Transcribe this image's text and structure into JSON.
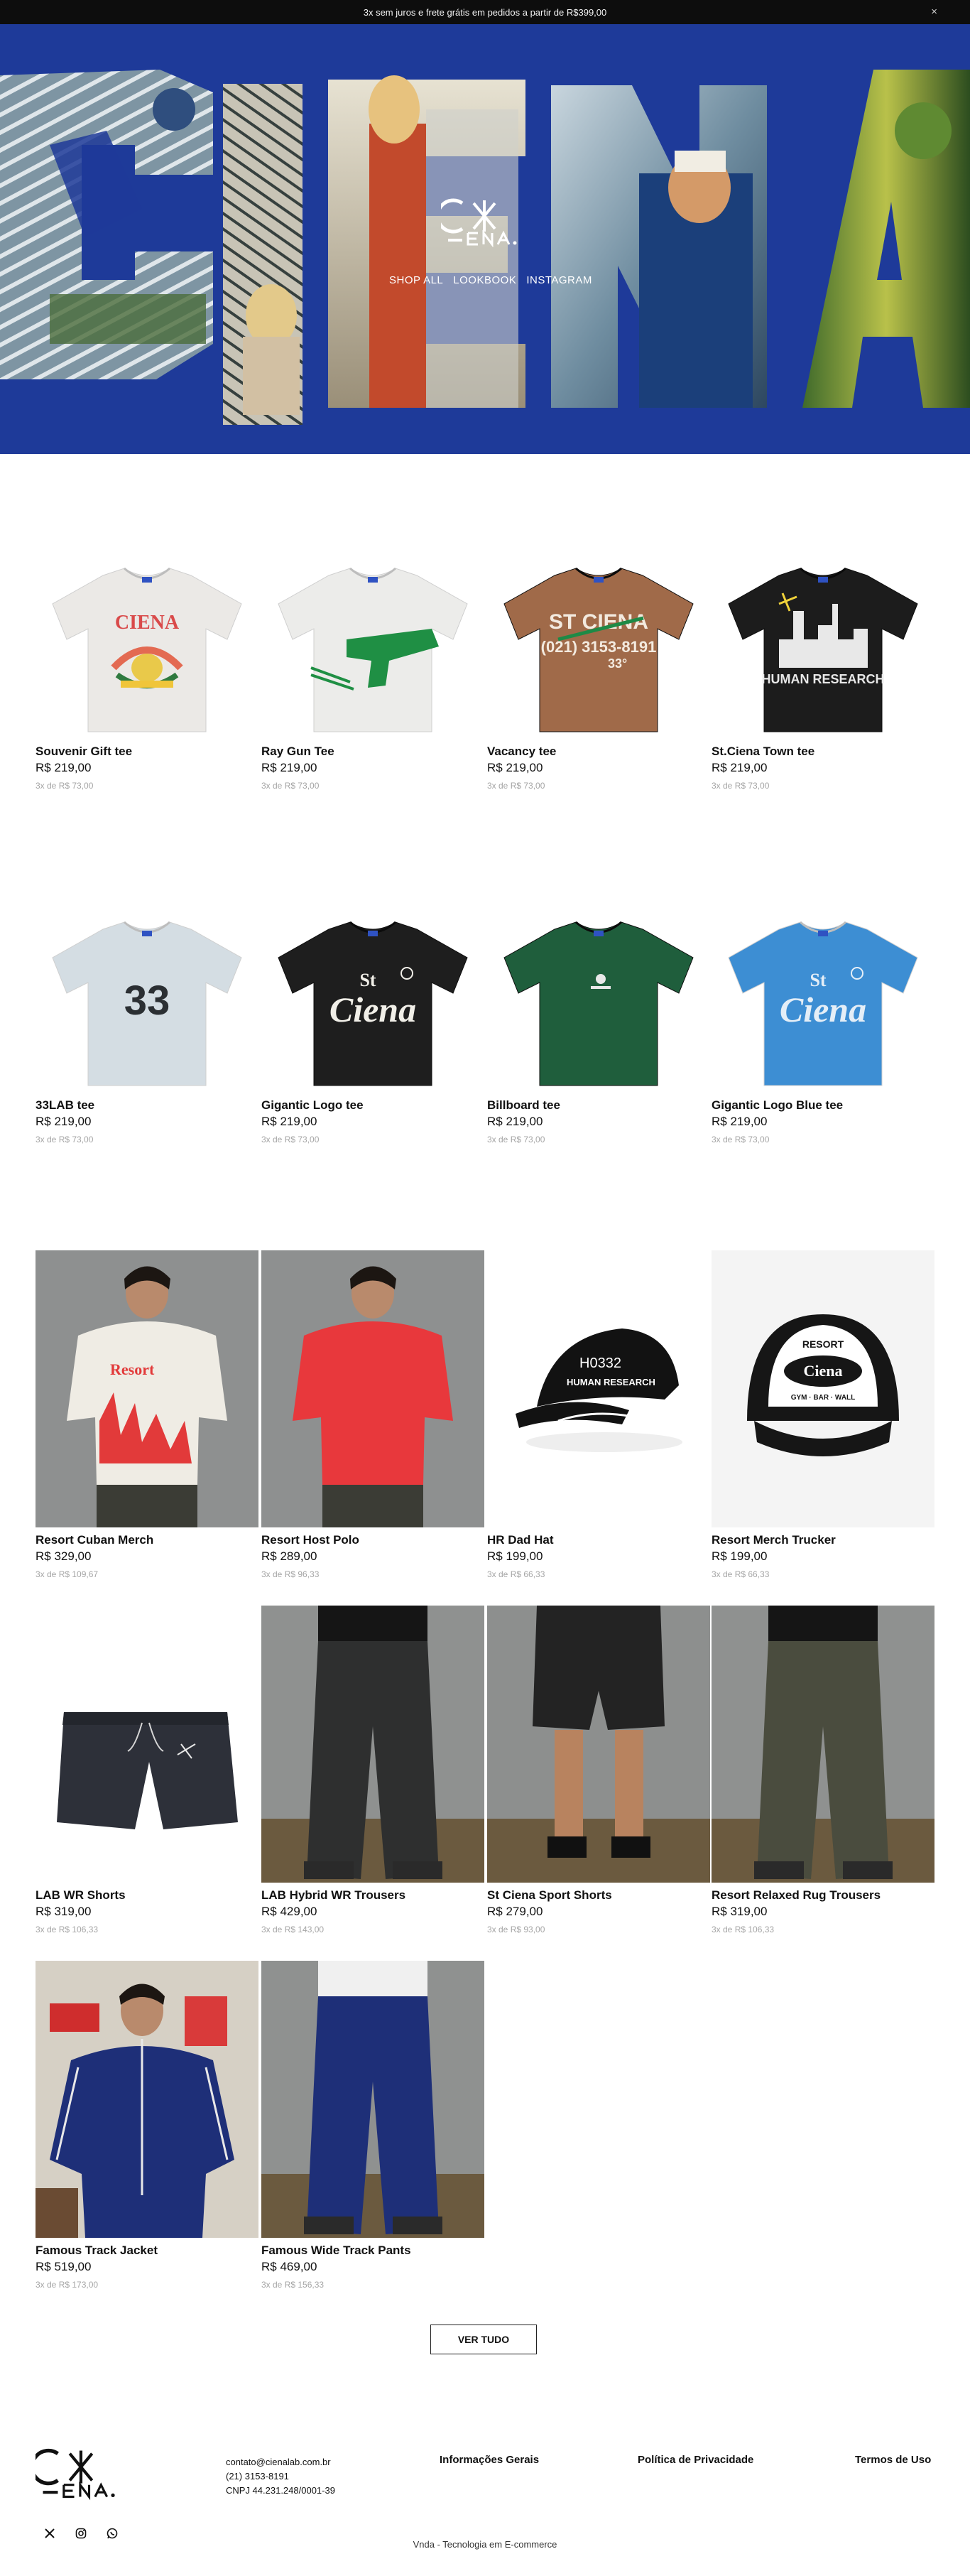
{
  "announcement": {
    "text": "3x sem juros e frete grátis em pedidos a partir de R$399,00",
    "close": "×"
  },
  "hero": {
    "background_color": "#1e3a99",
    "big_word": "CIENA",
    "nav": [
      "SHOP ALL",
      "LOOKBOOK",
      "INSTAGRAM"
    ]
  },
  "products": [
    {
      "name": "Souvenir Gift tee",
      "price": "R$ 219,00",
      "installments": "3x de R$ 73,00",
      "kind": "tee",
      "color": "#ebe9e6",
      "print": "souvenir"
    },
    {
      "name": "Ray Gun Tee",
      "price": "R$ 219,00",
      "installments": "3x de R$ 73,00",
      "kind": "tee",
      "color": "#ececea",
      "print": "raygun"
    },
    {
      "name": "Vacancy tee",
      "price": "R$ 219,00",
      "installments": "3x de R$ 73,00",
      "kind": "tee",
      "color": "#a06a49",
      "print": "vacancy"
    },
    {
      "name": "St.Ciena Town tee",
      "price": "R$ 219,00",
      "installments": "3x de R$ 73,00",
      "kind": "tee",
      "color": "#1c1c1c",
      "print": "town"
    },
    {
      "name": "33LAB tee",
      "price": "R$ 219,00",
      "installments": "3x de R$ 73,00",
      "kind": "tee",
      "color": "#d4dde3",
      "print": "33"
    },
    {
      "name": "Gigantic Logo tee",
      "price": "R$ 219,00",
      "installments": "3x de R$ 73,00",
      "kind": "tee",
      "color": "#1e1e1e",
      "print": "stciena-white"
    },
    {
      "name": "Billboard tee",
      "price": "R$ 219,00",
      "installments": "3x de R$ 73,00",
      "kind": "tee",
      "color": "#1f5e3c",
      "print": "small"
    },
    {
      "name": "Gigantic Logo Blue tee",
      "price": "R$ 219,00",
      "installments": "3x de R$ 73,00",
      "kind": "tee",
      "color": "#3d8ed3",
      "print": "stciena-light"
    },
    {
      "name": "Resort Cuban Merch",
      "price": "R$ 329,00",
      "installments": "3x de R$ 109,67",
      "kind": "model-shirt",
      "color": "#efece4",
      "print": "red"
    },
    {
      "name": "Resort Host Polo",
      "price": "R$ 289,00",
      "installments": "3x de R$ 96,33",
      "kind": "model-shirt",
      "color": "#e8383c",
      "print": "plain"
    },
    {
      "name": "HR Dad Hat",
      "price": "R$ 199,00",
      "installments": "3x de R$ 66,33",
      "kind": "cap",
      "color": "#141414",
      "print": "hr"
    },
    {
      "name": "Resort Merch Trucker",
      "price": "R$ 199,00",
      "installments": "3x de R$ 66,33",
      "kind": "trucker",
      "color": "#1a1a1a",
      "print": "resort"
    },
    {
      "name": "LAB WR Shorts",
      "price": "R$ 319,00",
      "installments": "3x de R$ 106,33",
      "kind": "shorts",
      "color": "#2d3039",
      "print": ""
    },
    {
      "name": "LAB Hybrid WR Trousers",
      "price": "R$ 429,00",
      "installments": "3x de R$ 143,00",
      "kind": "model-pants",
      "color": "#2e2f2f",
      "print": ""
    },
    {
      "name": "St Ciena Sport Shorts",
      "price": "R$ 279,00",
      "installments": "3x de R$ 93,00",
      "kind": "model-shorts",
      "color": "#232323",
      "print": ""
    },
    {
      "name": "Resort Relaxed Rug Trousers",
      "price": "R$ 319,00",
      "installments": "3x de R$ 106,33",
      "kind": "model-pants",
      "color": "#4a4c3e",
      "print": ""
    },
    {
      "name": "Famous Track Jacket",
      "price": "R$ 519,00",
      "installments": "3x de R$ 173,00",
      "kind": "model-jacket",
      "color": "#1e2f78",
      "print": ""
    },
    {
      "name": "Famous Wide Track Pants",
      "price": "R$ 469,00",
      "installments": "3x de R$ 156,33",
      "kind": "model-pants",
      "color": "#1e2f78",
      "print": ""
    }
  ],
  "view_all": "VER TUDO",
  "footer": {
    "email": "contato@cienalab.com.br",
    "phone": "(21) 3153-8191",
    "cnpj": "CNPJ 44.231.248/0001-39",
    "links": [
      "Informações Gerais",
      "Política de Privacidade",
      "Termos de Uso"
    ],
    "powered": "Vnda - Tecnologia em E-commerce"
  },
  "colors": {
    "accent": "#1e3a99",
    "text": "#111111",
    "muted": "#a5a5a5"
  }
}
